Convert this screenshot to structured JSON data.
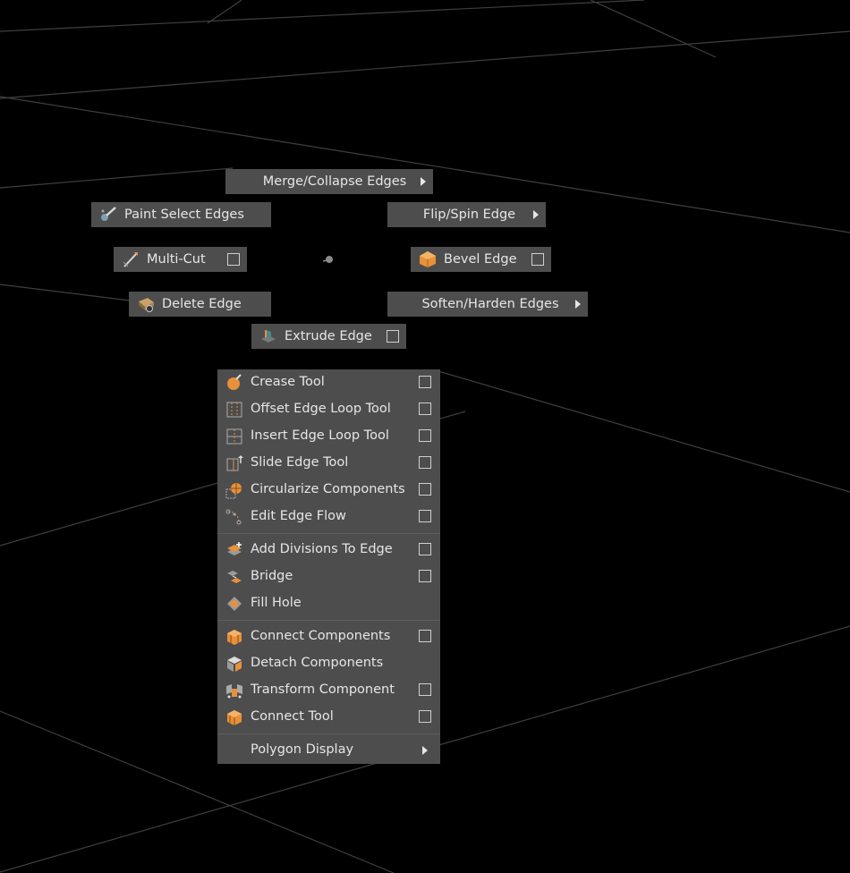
{
  "marking_menu": {
    "merge_collapse": "Merge/Collapse Edges",
    "paint_select": "Paint Select Edges",
    "flip_spin": "Flip/Spin Edge",
    "multi_cut": "Multi-Cut",
    "bevel_edge": "Bevel Edge",
    "delete_edge": "Delete Edge",
    "soften_harden": "Soften/Harden Edges",
    "extrude_edge": "Extrude Edge"
  },
  "menu": {
    "groups": [
      [
        {
          "label": "Crease Tool",
          "icon": "crease-icon",
          "option_box": true
        },
        {
          "label": "Offset Edge Loop Tool",
          "icon": "offset-edge-loop-icon",
          "option_box": true
        },
        {
          "label": "Insert Edge Loop Tool",
          "icon": "insert-edge-loop-icon",
          "option_box": true
        },
        {
          "label": "Slide Edge Tool",
          "icon": "slide-edge-icon",
          "option_box": true
        },
        {
          "label": "Circularize Components",
          "icon": "circularize-icon",
          "option_box": true
        },
        {
          "label": "Edit Edge Flow",
          "icon": "edit-edge-flow-icon",
          "option_box": true
        }
      ],
      [
        {
          "label": "Add Divisions To Edge",
          "icon": "add-divisions-icon",
          "option_box": true
        },
        {
          "label": "Bridge",
          "icon": "bridge-icon",
          "option_box": true
        },
        {
          "label": "Fill Hole",
          "icon": "fill-hole-icon",
          "option_box": false
        }
      ],
      [
        {
          "label": "Connect Components",
          "icon": "connect-components-icon",
          "option_box": true
        },
        {
          "label": "Detach Components",
          "icon": "detach-components-icon",
          "option_box": false
        },
        {
          "label": "Transform Component",
          "icon": "transform-component-icon",
          "option_box": true
        },
        {
          "label": "Connect Tool",
          "icon": "connect-tool-icon",
          "option_box": true
        }
      ]
    ],
    "polygon_display": "Polygon Display"
  },
  "colors": {
    "background": "#000000",
    "menu_bg": "#4d4d4d",
    "text": "#e6e6e6",
    "accent_orange": "#e8913a",
    "grid_line": "#3d3d3d"
  }
}
